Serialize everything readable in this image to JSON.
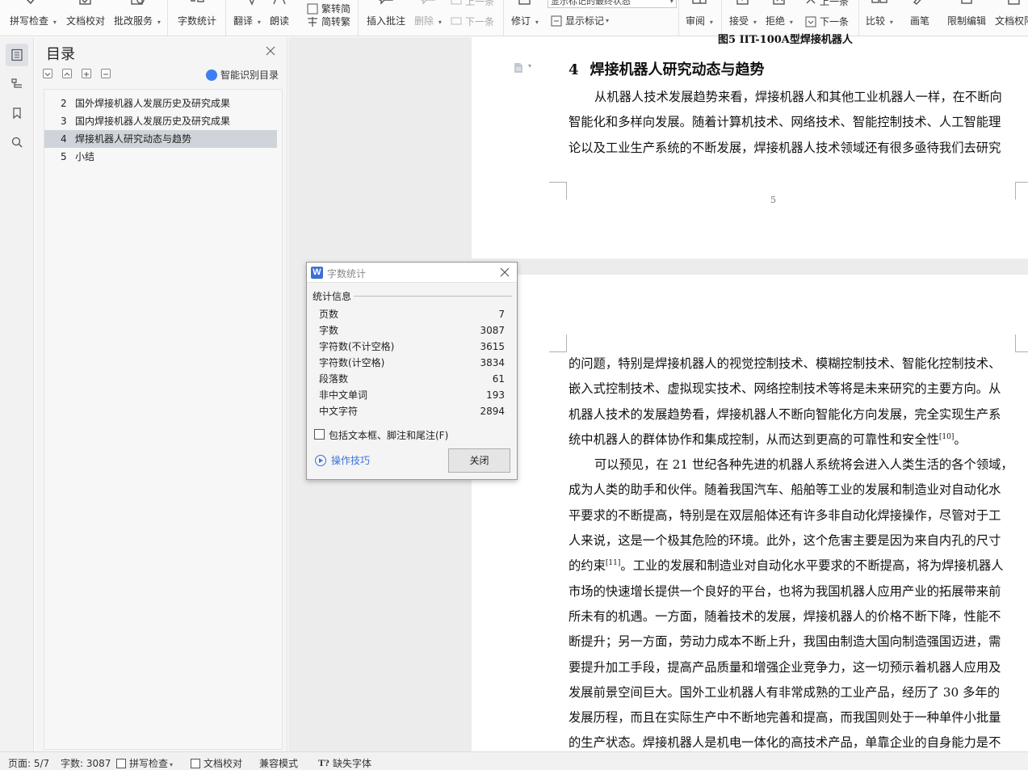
{
  "ribbon": {
    "spell_check": "拼写检查",
    "doc_proof": "文档校对",
    "review_service": "批改服务",
    "word_count": "字数统计",
    "translate": "翻译",
    "read_aloud": "朗读",
    "trad_conv": "繁转简",
    "simp_to_trad": "简转繁",
    "insert_comment": "插入批注",
    "delete": "删除",
    "prev_item": "上一条",
    "next_item": "下一条",
    "revise": "修订",
    "track_state": "显示标记的最终状态",
    "show_markup": "显示标记",
    "review": "审阅",
    "accept": "接受",
    "reject": "拒绝",
    "prev_change": "上一条",
    "next_change": "下一条",
    "compare": "比较",
    "pen": "画笔",
    "restrict_edit": "限制编辑",
    "doc_permission": "文档权限"
  },
  "toc": {
    "title": "目录",
    "smart_toc": "智能识别目录",
    "items": [
      {
        "num": "2",
        "label": "国外焊接机器人发展历史及研究成果"
      },
      {
        "num": "3",
        "label": "国内焊接机器人发展历史及研究成果"
      },
      {
        "num": "4",
        "label": "焊接机器人研究动态与趋势"
      },
      {
        "num": "5",
        "label": "小结"
      }
    ]
  },
  "document": {
    "figure_caption": "图5 IIT-100A型焊接机器人",
    "heading": {
      "num": "4",
      "text": "焊接机器人研究动态与趋势"
    },
    "page1_lines": [
      "从机器人技术发展趋势来看，焊接机器人和其他工业机器人一样，在不断向",
      "智能化和多样向发展。随着计算机技术、网络技术、智能控制技术、人工智能理",
      "论以及工业生产系统的不断发展，焊接机器人技术领域还有很多亟待我们去研究"
    ],
    "page_number": "5",
    "page2_lines": [
      "的问题，特别是焊接机器人的视觉控制技术、模糊控制技术、智能化控制技术、",
      "嵌入式控制技术、虚拟现实技术、网络控制技术等将是未来研究的主要方向。从",
      "机器人技术的发展趋势看，焊接机器人不断向智能化方向发展，完全实现生产系",
      "统中机器人的群体协作和集成控制，从而达到更高的可靠性和安全性",
      "可以预见，在 21 世纪各种先进的机器人系统将会进入人类生活的各个领域，",
      "成为人类的助手和伙伴。随着我国汽车、船舶等工业的发展和制造业对自动化水",
      "平要求的不断提高，特别是在双层船体还有许多非自动化焊接操作，尽管对于工",
      "人来说，这是一个极其危险的环境。此外，这个危害主要是因为来自内孔的尺寸",
      "的约束",
      "。工业的发展和制造业对自动化水平要求的不断提高，将为焊接机器人",
      "市场的快速增长提供一个良好的平台，也将为我国机器人应用产业的拓展带来前",
      "所未有的机遇。一方面，随着技术的发展，焊接机器人的价格不断下降，性能不",
      "断提升；另一方面，劳动力成本不断上升，我国由制造大国向制造强国迈进，需",
      "要提升加工手段，提高产品质量和增强企业竞争力，这一切预示着机器人应用及",
      "发展前景空间巨大。国外工业机器人有非常成熟的工业产品，经历了 30 多年的",
      "发展历程，而且在实际生产中不断地完善和提高，而我国则处于一种单件小批量",
      "的生产状态。焊接机器人是机电一体化的高技术产品，单靠企业的自身能力是不"
    ],
    "ref10": "[10]",
    "ref11": "[11]",
    "period": "。"
  },
  "word_count_dialog": {
    "title": "字数统计",
    "section": "统计信息",
    "rows": [
      {
        "label": "页数",
        "value": "7"
      },
      {
        "label": "字数",
        "value": "3087"
      },
      {
        "label": "字符数(不计空格)",
        "value": "3615"
      },
      {
        "label": "字符数(计空格)",
        "value": "3834"
      },
      {
        "label": "段落数",
        "value": "61"
      },
      {
        "label": "非中文单词",
        "value": "193"
      },
      {
        "label": "中文字符",
        "value": "2894"
      }
    ],
    "checkbox_label": "包括文本框、脚注和尾注(F)",
    "tips": "操作技巧",
    "close_button": "关闭"
  },
  "statusbar": {
    "page": "页面: 5/7",
    "words": "字数: 3087",
    "spell_check": "拼写检查",
    "doc_proof": "文档校对",
    "compat_mode": "兼容模式",
    "missing_font": "缺失字体"
  },
  "colors": {
    "accent": "#3b73d9",
    "selected_toc": "#cfd4da",
    "canvas": "#ececec"
  }
}
